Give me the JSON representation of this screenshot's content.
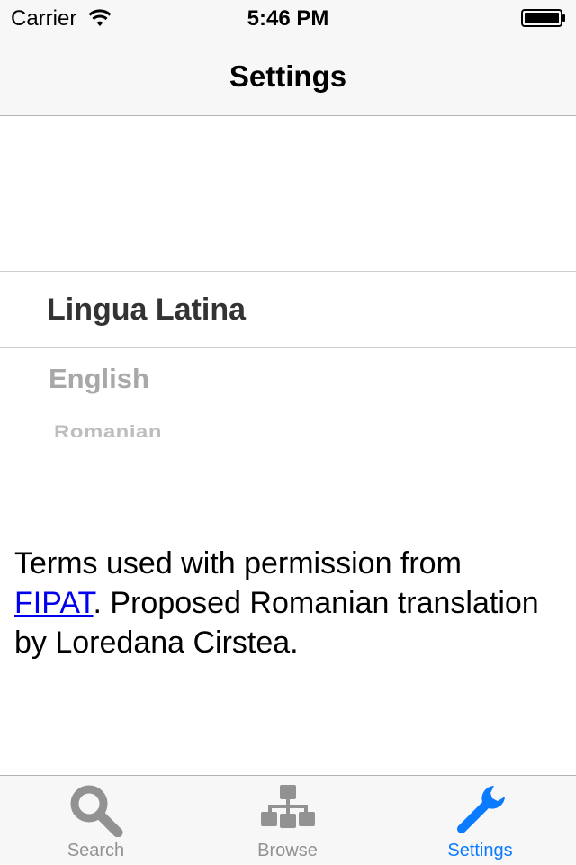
{
  "status_bar": {
    "carrier": "Carrier",
    "time": "5:46 PM"
  },
  "nav": {
    "title": "Settings"
  },
  "picker": {
    "selected": "Lingua Latina",
    "options": [
      "English",
      "Romanian"
    ]
  },
  "credit": {
    "text_before": "Terms used with permission from ",
    "link_text": "FIPAT",
    "text_after": ". Proposed Romanian translation by Loredana Cirstea."
  },
  "tabs": [
    {
      "label": "Search",
      "icon": "search-icon"
    },
    {
      "label": "Browse",
      "icon": "hierarchy-icon"
    },
    {
      "label": "Settings",
      "icon": "wrench-icon"
    }
  ],
  "colors": {
    "accent": "#0a7aff",
    "tab_inactive": "#929292",
    "bar_bg": "#f7f7f7",
    "link": "#0000ee"
  }
}
